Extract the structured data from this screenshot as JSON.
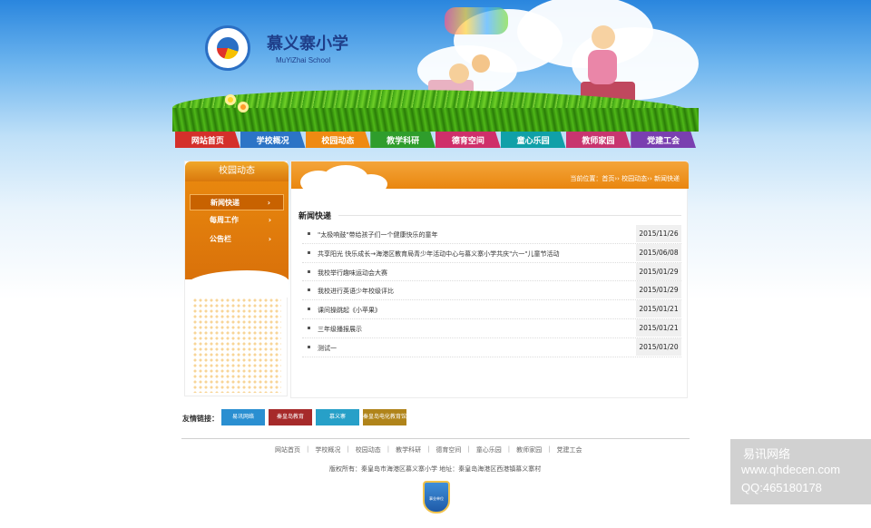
{
  "header": {
    "school_name": "慕义寨小学",
    "school_name_en": "MuYiZhai School"
  },
  "nav": {
    "items": [
      {
        "label": "网站首页",
        "color": "#d4302b"
      },
      {
        "label": "学校概况",
        "color": "#2c74c6"
      },
      {
        "label": "校园动态",
        "color": "#ef8a12"
      },
      {
        "label": "教学科研",
        "color": "#2f9d2c"
      },
      {
        "label": "德育空间",
        "color": "#cf2f6a"
      },
      {
        "label": "童心乐园",
        "color": "#10a0a8"
      },
      {
        "label": "教师家园",
        "color": "#c8356f"
      },
      {
        "label": "党建工会",
        "color": "#7a3fb0"
      }
    ]
  },
  "sidebar": {
    "title": "校园动态",
    "items": [
      {
        "label": "新闻快递",
        "arrow": "›"
      },
      {
        "label": "每周工作",
        "arrow": "›"
      },
      {
        "label": "公告栏",
        "arrow": "›"
      }
    ]
  },
  "main": {
    "breadcrumb": "当前位置：首页›› 校园动态›› 新闻快递",
    "section_title": "新闻快递",
    "news": [
      {
        "title": "\"太极响鼓\"带给孩子们一个健康快乐的童年",
        "date": "2015/11/26"
      },
      {
        "title": "共享阳光 快乐成长→海港区教育局青少年活动中心与慕义寨小学共庆\"六一\"儿童节活动",
        "date": "2015/06/08"
      },
      {
        "title": "我校举行趣味运动会大赛",
        "date": "2015/01/29"
      },
      {
        "title": "我校进行英语少年校级评比",
        "date": "2015/01/29"
      },
      {
        "title": "课间操跳起《小苹果》",
        "date": "2015/01/21"
      },
      {
        "title": "三年级播报展示",
        "date": "2015/01/21"
      },
      {
        "title": "测试一",
        "date": "2015/01/20"
      }
    ]
  },
  "links": {
    "label": "友情链接：",
    "items": [
      {
        "label": "易讯网络",
        "color": "#2a8fd1"
      },
      {
        "label": "秦皇岛教育",
        "color": "#a62a2a"
      },
      {
        "label": "慕义寨",
        "color": "#27a0c8"
      },
      {
        "label": "秦皇岛电化教育馆",
        "color": "#b0841a"
      }
    ]
  },
  "footer": {
    "nav": [
      "网站首页",
      "学校概况",
      "校园动态",
      "教学科研",
      "德育空间",
      "童心乐园",
      "教师家园",
      "党建工会"
    ],
    "copyright": "版权所有：秦皇岛市海港区慕义寨小学  地址：秦皇岛海港区西港镇慕义寨村",
    "badge": "事业单位"
  },
  "watermark": {
    "line1": "易讯网络",
    "line2": "www.qhdecen.com",
    "line3": "QQ:465180178"
  }
}
